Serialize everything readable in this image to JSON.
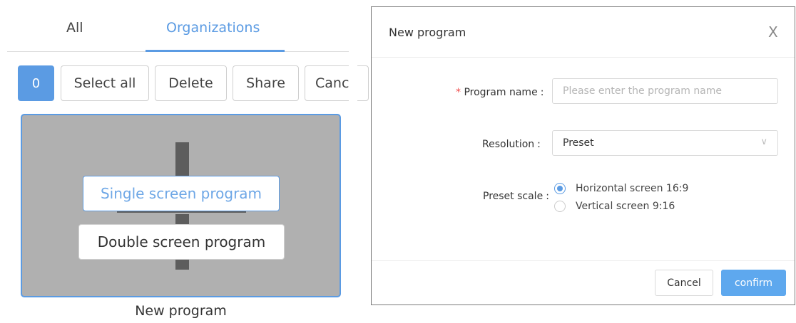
{
  "tabs": {
    "all": "All",
    "organizations": "Organizations"
  },
  "toolbar": {
    "selected_count": "0",
    "select_all": "Select all",
    "delete": "Delete",
    "share": "Share",
    "cancel_partial": "Canc"
  },
  "card": {
    "single_screen": "Single screen program",
    "double_screen": "Double screen program",
    "caption": "New program"
  },
  "modal": {
    "title": "New program",
    "close_glyph": "X",
    "required_mark": "*",
    "program_name_label": "Program name",
    "program_name_placeholder": "Please enter the program name",
    "program_name_value": "",
    "resolution_label": "Resolution",
    "resolution_value": "Preset",
    "preset_scale_label": "Preset scale",
    "scale_options": [
      {
        "label": "Horizontal screen 16:9",
        "selected": true
      },
      {
        "label": "Vertical screen 9:16",
        "selected": false
      }
    ],
    "colon": ":",
    "cancel": "Cancel",
    "confirm": "confirm"
  },
  "colors": {
    "accent": "#5b9be3",
    "confirm_bg": "#5ea8ee",
    "required": "#f05050",
    "card_bg": "#b0b0b0"
  }
}
